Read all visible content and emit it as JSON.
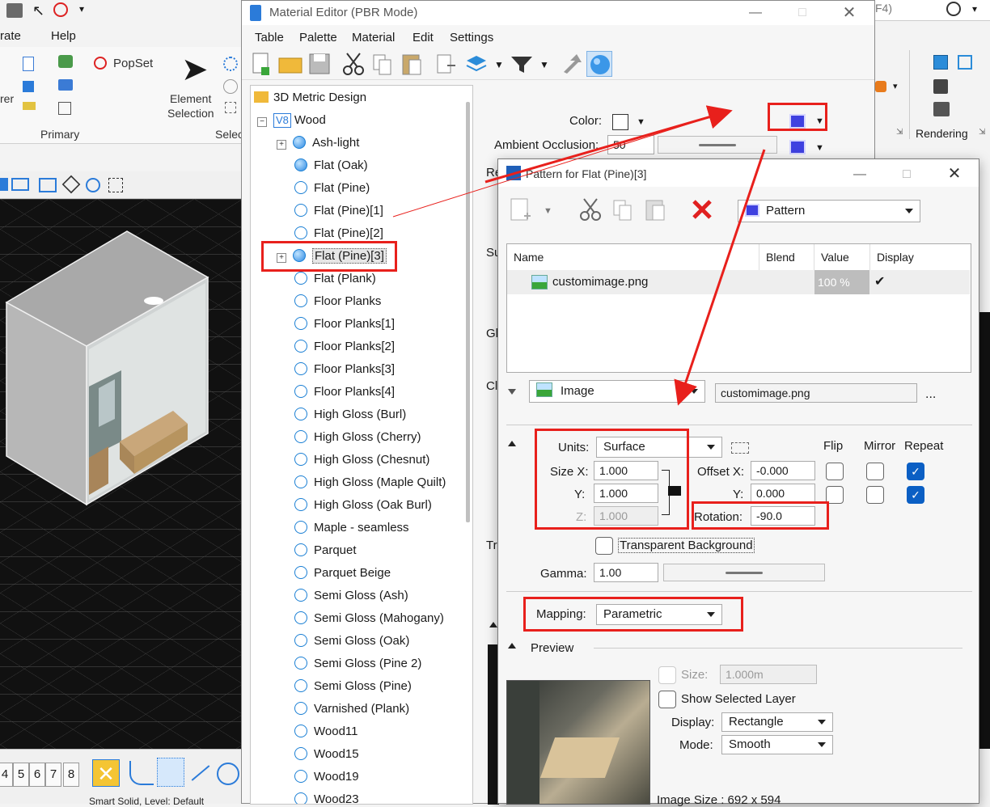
{
  "background_app": {
    "menu": [
      "rate",
      "Help"
    ],
    "ribbon": {
      "popset": "PopSet",
      "element_selection_line1": "Element",
      "element_selection_line2": "Selection",
      "left_partial": "rer",
      "group_primary": "Primary",
      "group_select_partial": "Selec"
    },
    "right": {
      "f4_partial": "F4)",
      "group_rendering": "Rendering"
    },
    "view_tabs": [
      "4",
      "5",
      "6",
      "7",
      "8"
    ],
    "status_text": "Smart Solid, Level: Default"
  },
  "material_editor": {
    "title": "Material Editor (PBR Mode)",
    "menu": [
      "Table",
      "Palette",
      "Material",
      "Edit",
      "Settings"
    ],
    "tree": {
      "root": "3D Metric Design",
      "palette": "Wood",
      "palette_badge": "V8",
      "items": [
        {
          "label": "Ash-light",
          "expandable": true,
          "filled": true
        },
        {
          "label": "Flat (Oak)",
          "expandable": false,
          "filled": true
        },
        {
          "label": "Flat (Pine)",
          "expandable": false,
          "filled": false
        },
        {
          "label": "Flat (Pine)[1]",
          "expandable": false,
          "filled": false
        },
        {
          "label": "Flat (Pine)[2]",
          "expandable": false,
          "filled": false
        },
        {
          "label": "Flat (Pine)[3]",
          "expandable": true,
          "filled": true,
          "selected": true
        },
        {
          "label": "Flat (Plank)",
          "expandable": false,
          "filled": false
        },
        {
          "label": "Floor Planks",
          "expandable": false,
          "filled": false
        },
        {
          "label": "Floor Planks[1]",
          "expandable": false,
          "filled": false
        },
        {
          "label": "Floor Planks[2]",
          "expandable": false,
          "filled": false
        },
        {
          "label": "Floor Planks[3]",
          "expandable": false,
          "filled": false
        },
        {
          "label": "Floor Planks[4]",
          "expandable": false,
          "filled": false
        },
        {
          "label": "High Gloss (Burl)",
          "expandable": false,
          "filled": false
        },
        {
          "label": "High Gloss (Cherry)",
          "expandable": false,
          "filled": false
        },
        {
          "label": "High Gloss (Chesnut)",
          "expandable": false,
          "filled": false
        },
        {
          "label": "High Gloss (Maple Quilt)",
          "expandable": false,
          "filled": false
        },
        {
          "label": "High Gloss (Oak Burl)",
          "expandable": false,
          "filled": false
        },
        {
          "label": "Maple - seamless",
          "expandable": false,
          "filled": false
        },
        {
          "label": "Parquet",
          "expandable": false,
          "filled": false
        },
        {
          "label": "Parquet Beige",
          "expandable": false,
          "filled": false
        },
        {
          "label": "Semi Gloss (Ash)",
          "expandable": false,
          "filled": false
        },
        {
          "label": "Semi Gloss (Mahogany)",
          "expandable": false,
          "filled": false
        },
        {
          "label": "Semi Gloss (Oak)",
          "expandable": false,
          "filled": false
        },
        {
          "label": "Semi Gloss (Pine 2)",
          "expandable": false,
          "filled": false
        },
        {
          "label": "Semi Gloss (Pine)",
          "expandable": false,
          "filled": false
        },
        {
          "label": "Varnished (Plank)",
          "expandable": false,
          "filled": false
        },
        {
          "label": "Wood11",
          "expandable": false,
          "filled": false
        },
        {
          "label": "Wood15",
          "expandable": false,
          "filled": false
        },
        {
          "label": "Wood19",
          "expandable": false,
          "filled": false
        },
        {
          "label": "Wood23",
          "expandable": false,
          "filled": false
        }
      ]
    },
    "props": {
      "color_label": "Color:",
      "ambient_occlusion_label": "Ambient Occlusion:",
      "ambient_occlusion_value": "50",
      "partial_labels": [
        "Re",
        "Su",
        "Gl",
        "Cl",
        "Tra"
      ]
    }
  },
  "pattern_dialog": {
    "title": "Pattern for Flat (Pine)[3]",
    "type_combo": "Pattern",
    "table": {
      "headers": [
        "Name",
        "Blend",
        "Value",
        "Display"
      ],
      "rows": [
        {
          "name": "customimage.png",
          "blend": "",
          "value": "100 %",
          "display": "✔"
        }
      ]
    },
    "image_source": "Image",
    "image_file": "customimage.png",
    "more": "...",
    "units_label": "Units:",
    "units_value": "Surface",
    "size_x_label": "Size X:",
    "size_x_value": "1.000",
    "size_y_label": "Y:",
    "size_y_value": "1.000",
    "size_z_label": "Z:",
    "size_z_value": "1.000",
    "offset_x_label": "Offset X:",
    "offset_x_value": "-0.000",
    "offset_y_label": "Y:",
    "offset_y_value": "0.000",
    "rotation_label": "Rotation:",
    "rotation_value": "-90.0",
    "flip_label": "Flip",
    "mirror_label": "Mirror",
    "repeat_label": "Repeat",
    "flip_x": false,
    "flip_y": false,
    "mirror_x": false,
    "mirror_y": false,
    "repeat_x": true,
    "repeat_y": true,
    "transparent_bg_label": "Transparent Background",
    "gamma_label": "Gamma:",
    "gamma_value": "1.00",
    "mapping_label": "Mapping:",
    "mapping_value": "Parametric",
    "preview_label": "Preview",
    "preview_size_label": "Size:",
    "preview_size_value": "1.000m",
    "show_selected_layer_label": "Show Selected Layer",
    "display_label": "Display:",
    "display_value": "Rectangle",
    "mode_label": "Mode:",
    "mode_value": "Smooth",
    "image_size": "Image Size : 692 x 594"
  },
  "colors": {
    "annotation_red": "#e8201c",
    "accent_blue": "#0b5fc4"
  }
}
